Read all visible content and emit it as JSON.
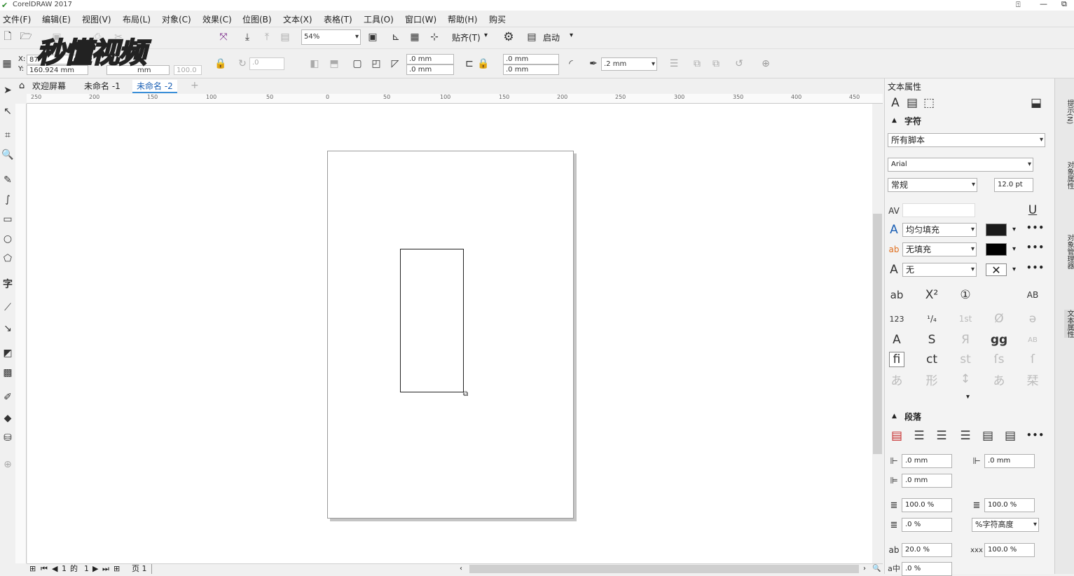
{
  "app": {
    "title": "CorelDRAW 2017"
  },
  "menu": [
    "文件(F)",
    "编辑(E)",
    "视图(V)",
    "布局(L)",
    "对象(C)",
    "效果(C)",
    "位图(B)",
    "文本(X)",
    "表格(T)",
    "工具(O)",
    "窗口(W)",
    "帮助(H)",
    "购买"
  ],
  "toolbar": {
    "zoom": "54%",
    "snap_label": "贴齐(T)",
    "launch_label": "启动"
  },
  "propbar": {
    "x_label": "X:",
    "x_value": "87",
    "y_label": "Y:",
    "y_value": "160.924 mm",
    "w_unit": "mm",
    "scale": "100.0",
    "rotate": ".0",
    "corner1": ".0 mm",
    "corner2": ".0 mm",
    "corner3": ".0 mm",
    "corner4": ".0 mm",
    "outline": ".2 mm"
  },
  "tabs": [
    "欢迎屏幕",
    "未命名 -1",
    "未命名 -2"
  ],
  "ruler_h": [
    "250",
    "200",
    "150",
    "100",
    "50",
    "0",
    "50",
    "100",
    "150",
    "200",
    "250",
    "300",
    "350",
    "400",
    "450"
  ],
  "statusbar": {
    "page_num": "1",
    "of": "的",
    "total": "1",
    "page_tab": "页 1"
  },
  "panel": {
    "title": "文本属性",
    "char_section": "字符",
    "script": "所有脚本",
    "font": "Arial",
    "style": "常规",
    "size": "12.0 pt",
    "fill": "均匀填充",
    "bg_fill": "无填充",
    "outline": "无",
    "fill_color": "#1a1a1a",
    "bg_color": "#000000",
    "para_section": "段落",
    "indent_left": ".0 mm",
    "indent_first": ".0 mm",
    "indent_right": ".0 mm",
    "line_spacing": "100.0 %",
    "char_spacing": "100.0 %",
    "before_para": ".0 %",
    "spacing_unit": "%字符高度",
    "lang_spacing": "20.0 %",
    "word_spacing": "100.0 %",
    "last": ".0 %"
  },
  "dock": [
    "提示(N)",
    "对象属性",
    "对象管理器",
    "文本属性"
  ],
  "watermark": "秒懂视频"
}
